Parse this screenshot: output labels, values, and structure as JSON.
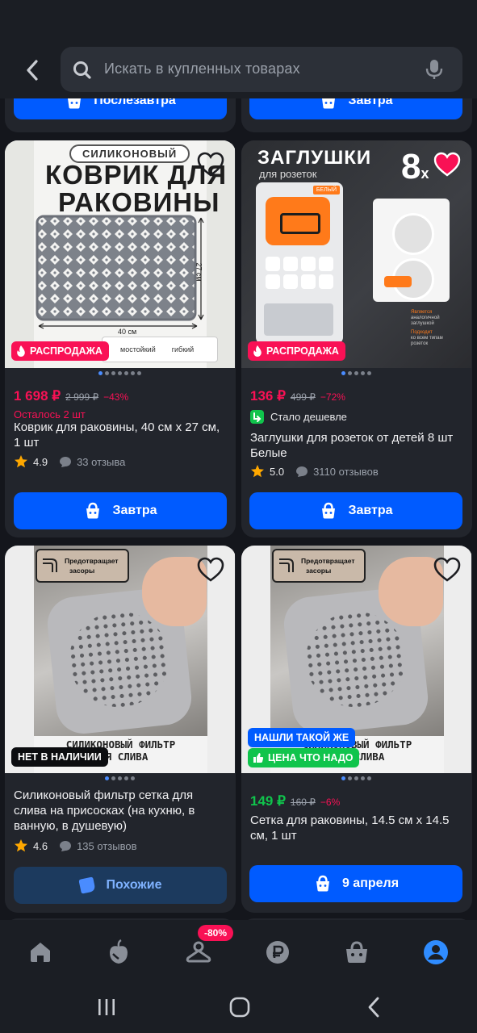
{
  "search": {
    "placeholder": "Искать в купленных товарах"
  },
  "top_cards": [
    {
      "button": "Послезавтра"
    },
    {
      "button": "Завтра"
    }
  ],
  "products": [
    {
      "badge": "РАСПРОДАЖА",
      "price": "1 698 ₽",
      "old_price": "2 999 ₽",
      "discount": "−43%",
      "stock": "Осталось 2 шт",
      "title": "Коврик для раковины, 40 см  х 27 см, 1 шт",
      "rating": "4.9",
      "reviews": "33 отзыва",
      "button": "Завтра",
      "favorited": false,
      "image_text": {
        "chip": "СИЛИКОНОВЫЙ",
        "line1": "КОВРИК ДЛЯ",
        "line2": "РАКОВИНЫ",
        "dim_w": "40 см",
        "dim_h": "27 см",
        "foot1": "мостойкий",
        "foot2": "гибкий"
      }
    },
    {
      "badge": "РАСПРОДАЖА",
      "price": "136 ₽",
      "old_price": "499 ₽",
      "discount": "−72%",
      "cheaper": "Стало дешевле",
      "title": "Заглушки для розеток от детей 8 шт Белые",
      "rating": "5.0",
      "reviews": "3110 отзывов",
      "button": "Завтра",
      "favorited": true,
      "image_text": {
        "head": "ЗАГЛУШКИ",
        "sub": "для розеток",
        "count": "8",
        "mult": "x",
        "tag": "БЕЛЫЙ",
        "note1": "Является",
        "note2": "аналогичной",
        "note3": "заглушкой",
        "note4": "Подходит",
        "note5": "ко всем типам",
        "note6": "розеток"
      }
    },
    {
      "badge": "НЕТ В НАЛИЧИИ",
      "title": "Силиконовый фильтр сетка для слива на присосках (на кухню, в ванную, в душевую)",
      "rating": "4.6",
      "reviews": "135 отзывов",
      "button": "Похожие",
      "favorited": false,
      "image_text": {
        "top1": "Предотвращает",
        "top2": "засоры",
        "bottom1": "СИЛИКОНОВЫЙ ФИЛЬТР",
        "bottom2": "ДЛЯ СЛИВА"
      }
    },
    {
      "badge_top": "НАШЛИ ТАКОЙ ЖЕ",
      "badge_bottom": "ЦЕНА ЧТО НАДО",
      "price": "149 ₽",
      "old_price": "160 ₽",
      "discount": "−6%",
      "title": "Сетка для раковины, 14.5 см  х 14.5 см, 1 шт",
      "button": "9 апреля",
      "favorited": false,
      "image_text": {
        "top1": "Предотвращает",
        "top2": "засоры",
        "bottom1": "СИЛИКОНОВЫЙ ФИЛЬТР",
        "bottom2": "ДЛЯ СЛИВА"
      }
    }
  ],
  "nav": {
    "promo": "-80%",
    "items": [
      "home-icon",
      "fresh-icon",
      "hanger-icon",
      "ruble-icon",
      "cart-icon",
      "profile-icon"
    ],
    "active": "profile-icon"
  },
  "colors": {
    "accent": "#005bff",
    "sale": "#f91155",
    "green": "#10c44c",
    "bg": "#14161c",
    "card": "#22252c"
  }
}
